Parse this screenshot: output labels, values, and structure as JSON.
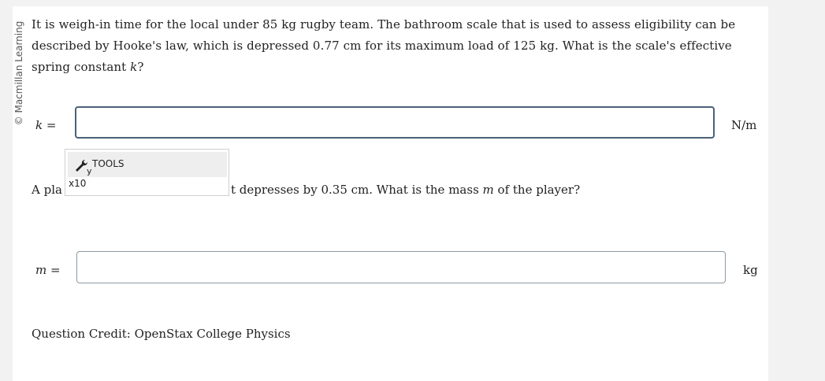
{
  "side_credit": "© Macmillan Learning",
  "question1": {
    "text": "It is weigh-in time for the local under 85 kg rugby team. The bathroom scale that is used to assess eligibility can be described by Hooke's law, which is depressed 0.77 cm for its maximum load of 125 kg. What is the scale's effective spring constant ",
    "var": "k",
    "end": "?"
  },
  "answer1": {
    "var": "k",
    "eq": " =",
    "value": "",
    "unit": "N/m"
  },
  "tools_popup": {
    "tools_label": "TOOLS",
    "tools_sub": "y",
    "x10_label": "x10"
  },
  "question2": {
    "prefix": "A pla",
    "suffix": "t depresses by 0.35 cm. What is the mass ",
    "var": "m",
    "end": " of the player?"
  },
  "answer2": {
    "var": "m",
    "eq": " =",
    "value": "",
    "unit": "kg"
  },
  "credit": "Question Credit: OpenStax College Physics"
}
